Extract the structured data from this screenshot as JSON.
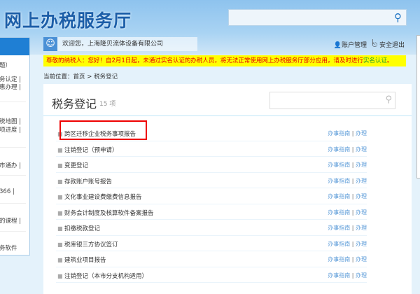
{
  "header": {
    "title": "网上办税服务厅",
    "search_placeholder": ""
  },
  "user": {
    "welcome": "欢迎您，上海隆贝流体设备有限公司",
    "account": "账户管理",
    "separator": "|",
    "logout": "安全退出"
  },
  "notice": {
    "text": "尊敬的纳税人：您好！自2月1日起，未通过实名认证的办税人员，将无法正常使用网上办税服务厅部分应用，请及时进行",
    "link": "实名认证",
    "end": "。"
  },
  "breadcrumb": {
    "label": "当前位置：",
    "home": "首页",
    "sep": ">",
    "current": "税务登记"
  },
  "sidebar": {
    "items": [
      "题）",
      "务认定 |",
      "惠办理 |",
      "税地图 |",
      "项进度 |",
      "市通办 |",
      "366    |",
      "的课程 |",
      "务软件"
    ]
  },
  "panel": {
    "title": "税务登记",
    "count": "15 项",
    "search_placeholder": "",
    "items": [
      {
        "name": "跨区迁移企业税务事项报告"
      },
      {
        "name": "注销登记（预申请）"
      },
      {
        "name": "变更登记"
      },
      {
        "name": "存款账户账号报告"
      },
      {
        "name": "文化事业建设费缴费信息报告"
      },
      {
        "name": "财务会计制度及核算软件备案报告"
      },
      {
        "name": "扣缴税款登记"
      },
      {
        "name": "税库银三方协议签订"
      },
      {
        "name": "建筑业项目报告"
      },
      {
        "name": "注销登记（本市分支机构适用）"
      }
    ],
    "guide_label": "办事指南",
    "sep": "|",
    "handle_label": "办理"
  },
  "colors": {
    "accent": "#1f7fd4",
    "notice_bg": "#ffff00",
    "notice_text": "#e60000",
    "highlight": "#ee0000"
  }
}
